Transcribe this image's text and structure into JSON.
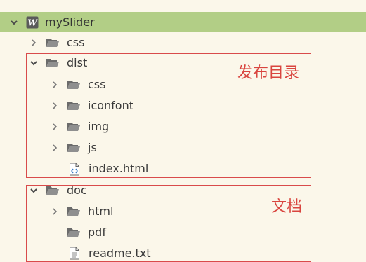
{
  "tree": {
    "root": {
      "label": "mySlider"
    },
    "items": [
      {
        "label": "css"
      },
      {
        "label": "dist"
      },
      {
        "label": "css"
      },
      {
        "label": "iconfont"
      },
      {
        "label": "img"
      },
      {
        "label": "js"
      },
      {
        "label": "index.html"
      },
      {
        "label": "doc"
      },
      {
        "label": "html"
      },
      {
        "label": "pdf"
      },
      {
        "label": "readme.txt"
      }
    ]
  },
  "annotations": {
    "dist_note": "发布目录",
    "doc_note": "文档"
  },
  "colors": {
    "root_highlight": "#b2ce86",
    "background": "#fbf7ea",
    "annotation": "#d94b4b",
    "folder_icon": "#5c5c5c",
    "html_icon": "#3b7dc4"
  }
}
